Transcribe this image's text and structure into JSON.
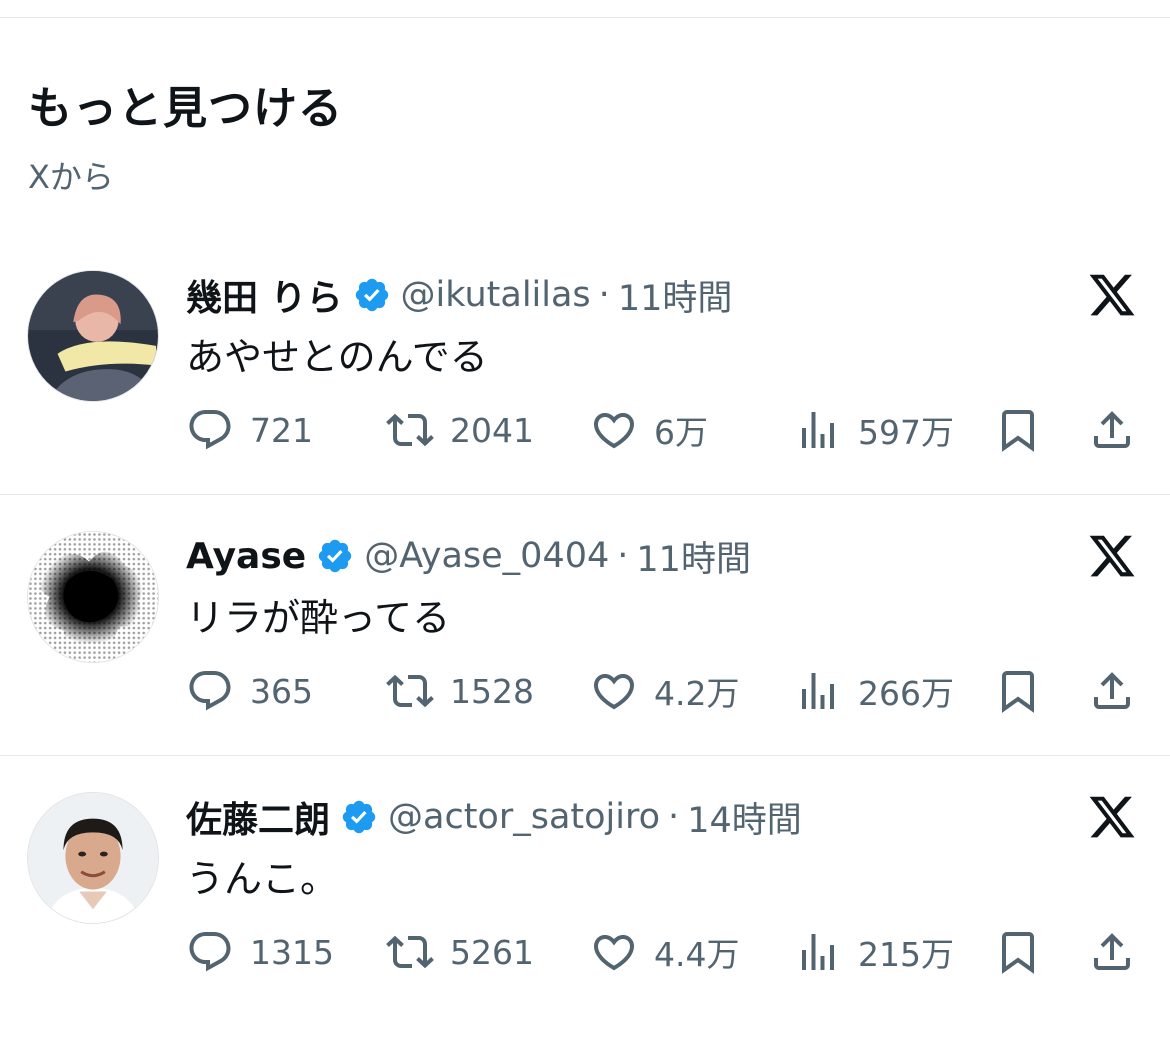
{
  "section": {
    "title": "もっと見つける",
    "subtitle": "Xから"
  },
  "colors": {
    "verified": "#1d9bf0",
    "text": "#0f1419",
    "secondary": "#536471",
    "divider": "#e6e8ea"
  },
  "icons": [
    "reply-icon",
    "repost-icon",
    "like-icon",
    "views-icon",
    "bookmark-icon",
    "share-icon",
    "verified-badge-icon",
    "x-logo-icon"
  ],
  "posts": [
    {
      "display_name": "幾田 りら",
      "handle": "@ikutalilas",
      "separator": "·",
      "time": "11時間",
      "text": "あやせとのんでる",
      "replies": "721",
      "reposts": "2041",
      "likes": "6万",
      "views": "597万"
    },
    {
      "display_name": "Ayase",
      "handle": "@Ayase_0404",
      "separator": "·",
      "time": "11時間",
      "text": "リラが酔ってる",
      "replies": "365",
      "reposts": "1528",
      "likes": "4.2万",
      "views": "266万"
    },
    {
      "display_name": "佐藤二朗",
      "handle": "@actor_satojiro",
      "separator": "·",
      "time": "14時間",
      "text": "うんこ。",
      "replies": "1315",
      "reposts": "5261",
      "likes": "4.4万",
      "views": "215万"
    }
  ]
}
